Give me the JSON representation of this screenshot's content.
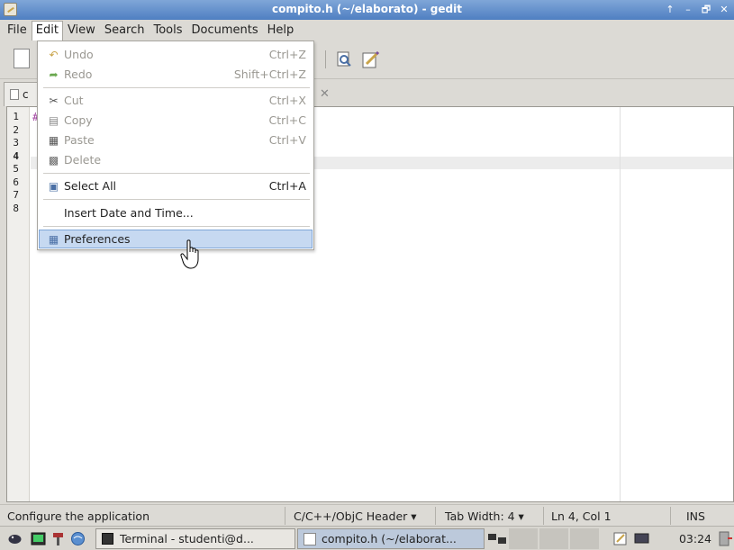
{
  "window": {
    "title": "compito.h (~/elaborato) - gedit",
    "buttons": [
      "↑",
      "–",
      "🗗",
      "✕"
    ]
  },
  "menubar": {
    "items": [
      {
        "label": "File",
        "underline": "F"
      },
      {
        "label": "Edit",
        "underline": "E"
      },
      {
        "label": "View",
        "underline": "V"
      },
      {
        "label": "Search",
        "underline": "S"
      },
      {
        "label": "Tools",
        "underline": "T"
      },
      {
        "label": "Documents",
        "underline": "D"
      },
      {
        "label": "Help",
        "underline": "H"
      }
    ]
  },
  "tab": {
    "label": "c",
    "close_glyph": "✕"
  },
  "editor": {
    "line_numbers": [
      "1",
      "2",
      "3",
      "4",
      "5",
      "6",
      "7",
      "8"
    ],
    "current_line": "4",
    "first_line_text": "#"
  },
  "edit_menu": {
    "undo": {
      "label": "Undo",
      "accel": "Ctrl+Z"
    },
    "redo": {
      "label": "Redo",
      "accel": "Shift+Ctrl+Z"
    },
    "cut": {
      "label": "Cut",
      "accel": "Ctrl+X"
    },
    "copy": {
      "label": "Copy",
      "accel": "Ctrl+C"
    },
    "paste": {
      "label": "Paste",
      "accel": "Ctrl+V"
    },
    "delete": {
      "label": "Delete",
      "accel": ""
    },
    "select_all": {
      "label": "Select All",
      "accel": "Ctrl+A"
    },
    "insert_date": {
      "label": "Insert Date and Time...",
      "accel": ""
    },
    "preferences": {
      "label": "Preferences",
      "accel": ""
    }
  },
  "statusbar": {
    "message": "Configure the application",
    "language": "C/C++/ObjC Header ▾",
    "tab_width": "Tab Width: 4 ▾",
    "position": "Ln 4, Col 1",
    "mode": "INS"
  },
  "taskbar": {
    "terminal_label": "Terminal - studenti@d...",
    "gedit_label": "compito.h (~/elaborat...",
    "clock": "03:24"
  },
  "colors": {
    "titlebar": "#5f8ccb",
    "menu_highlight": "#c6d9f1",
    "preproc": "#a040a0"
  }
}
